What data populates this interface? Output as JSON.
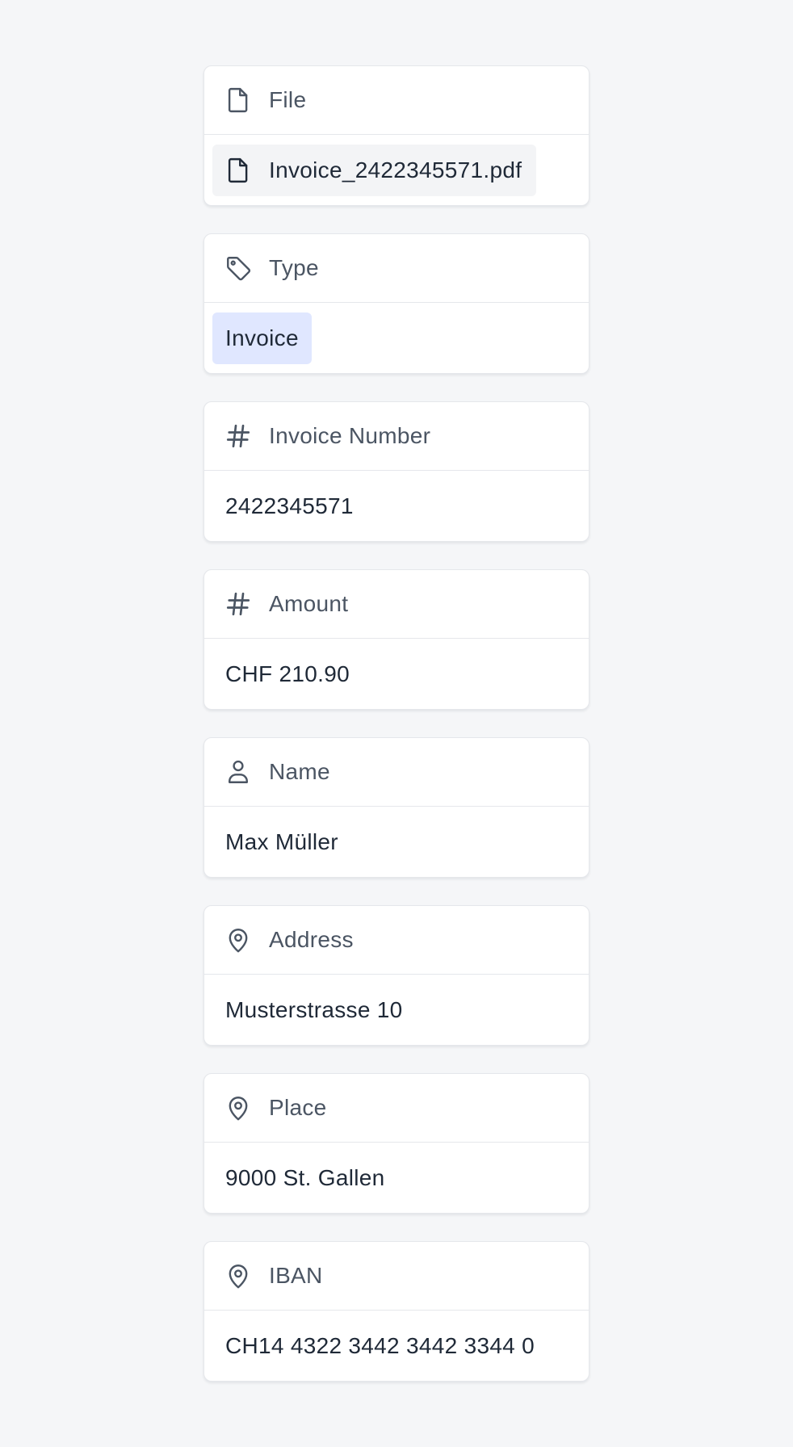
{
  "fields": {
    "file": {
      "label": "File",
      "icon": "document-icon",
      "value": "Invoice_2422345571.pdf",
      "value_icon": "document-icon"
    },
    "type": {
      "label": "Type",
      "icon": "tag-icon",
      "value": "Invoice",
      "badge_color": "#e0e7ff"
    },
    "invoice_number": {
      "label": "Invoice Number",
      "icon": "hash-icon",
      "value": "2422345571"
    },
    "amount": {
      "label": "Amount",
      "icon": "hash-icon",
      "value": "CHF 210.90"
    },
    "name": {
      "label": "Name",
      "icon": "user-icon",
      "value": "Max Müller"
    },
    "address": {
      "label": "Address",
      "icon": "map-pin-icon",
      "value": "Musterstrasse 10"
    },
    "place": {
      "label": "Place",
      "icon": "map-pin-icon",
      "value": "9000 St. Gallen"
    },
    "iban": {
      "label": "IBAN",
      "icon": "map-pin-icon",
      "value": "CH14 4322 3442 3442 3344 0"
    }
  },
  "colors": {
    "background": "#f5f6f8",
    "card": "#ffffff",
    "border": "#e5e7eb",
    "label": "#4b5563",
    "value": "#1f2937",
    "chip": "#f3f4f6",
    "badge": "#e0e7ff"
  }
}
